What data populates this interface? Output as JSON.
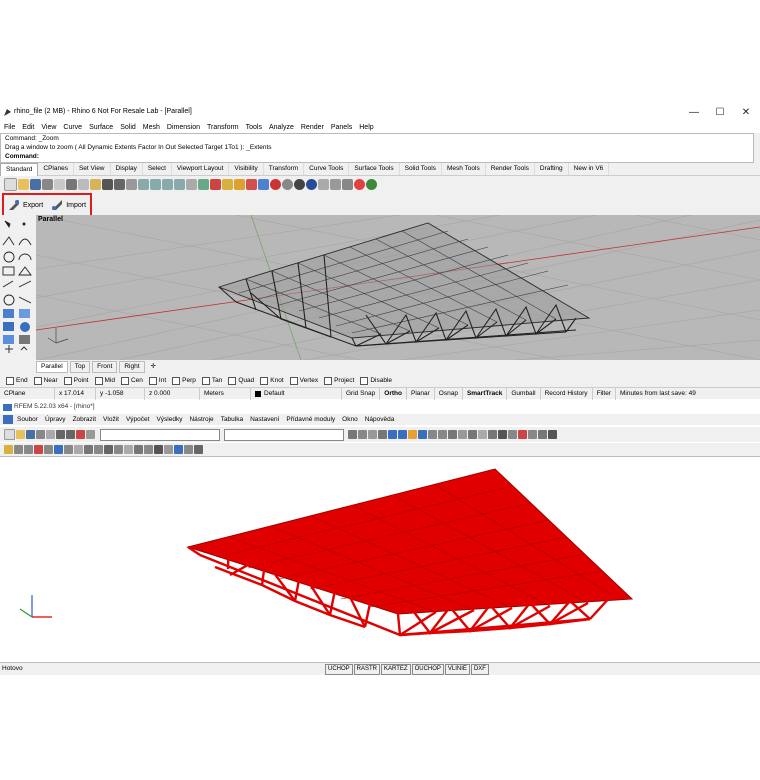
{
  "rhino": {
    "title": "rhino_file (2 MB) - Rhino 6 Not For Resale Lab - [Parallel]",
    "menu": [
      "File",
      "Edit",
      "View",
      "Curve",
      "Surface",
      "Solid",
      "Mesh",
      "Dimension",
      "Transform",
      "Tools",
      "Analyze",
      "Render",
      "Panels",
      "Help"
    ],
    "command_history": [
      "Command: _Zoom",
      "Drag a window to zoom ( All  Dynamic  Extents  Factor  In  Out  Selected  Target  1To1 ): _Extents"
    ],
    "command_prompt": "Command:",
    "toolbar_tabs": [
      "Standard",
      "CPlanes",
      "Set View",
      "Display",
      "Select",
      "Viewport Layout",
      "Visibility",
      "Transform",
      "Curve Tools",
      "Surface Tools",
      "Solid Tools",
      "Mesh Tools",
      "Render Tools",
      "Drafting",
      "New in V6"
    ],
    "export_label": "Export",
    "import_label": "Import",
    "viewport_label": "Parallel",
    "viewport_tabs": [
      "Parallel",
      "Top",
      "Front",
      "Right"
    ],
    "osnaps": [
      {
        "label": "End",
        "checked": false
      },
      {
        "label": "Near",
        "checked": false
      },
      {
        "label": "Point",
        "checked": false
      },
      {
        "label": "Mid",
        "checked": false
      },
      {
        "label": "Cen",
        "checked": false
      },
      {
        "label": "Int",
        "checked": false
      },
      {
        "label": "Perp",
        "checked": false
      },
      {
        "label": "Tan",
        "checked": false
      },
      {
        "label": "Quad",
        "checked": false
      },
      {
        "label": "Knot",
        "checked": false
      },
      {
        "label": "Vertex",
        "checked": false
      },
      {
        "label": "Project",
        "checked": false
      },
      {
        "label": "Disable",
        "checked": false
      }
    ],
    "status": {
      "cplane": "CPlane",
      "x": "x 17.014",
      "y": "y -1.058",
      "z": "z 0.000",
      "units": "Meters",
      "layer": "Default",
      "toggles": [
        "Grid Snap",
        "Ortho",
        "Planar",
        "Osnap",
        "SmartTrack",
        "Gumball",
        "Record History",
        "Filter"
      ],
      "save_msg": "Minutes from last save: 49"
    }
  },
  "rfem": {
    "title": "RFEM 5.22.03 x64 - [rhino*]",
    "menu": [
      "Soubor",
      "Úpravy",
      "Zobrazit",
      "Vložit",
      "Výpočet",
      "Výsledky",
      "Nástroje",
      "Tabulka",
      "Nastavení",
      "Přídavné moduly",
      "Okno",
      "Nápověda"
    ],
    "status_left": "Hotovo",
    "status_buttons": [
      "UCHOP",
      "RASTR",
      "KARTEZ",
      "OUCHOP",
      "VLINIE",
      "DXF"
    ]
  },
  "colors": {
    "accent_red": "#e01b1b",
    "rhino_viewport": "#b8b8b8",
    "rfem_model": "#e00000"
  },
  "icons": [
    "save-icon",
    "undo-icon",
    "pan-icon",
    "zoom-icon",
    "export-icon",
    "import-icon",
    "axis-icon"
  ]
}
